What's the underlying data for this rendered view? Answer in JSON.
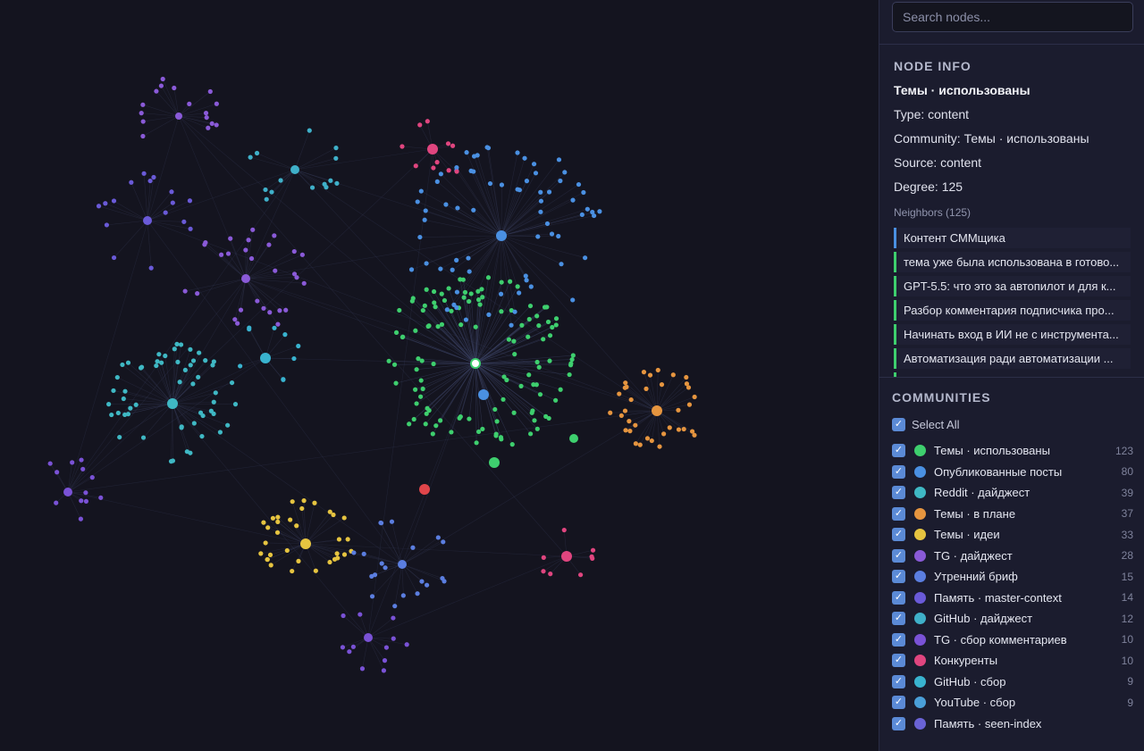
{
  "search": {
    "placeholder": "Search nodes..."
  },
  "node_info": {
    "title": "NODE INFO",
    "name": "Темы · использованы",
    "type_line": "Type: content",
    "community_line": "Community: Темы · использованы",
    "source_line": "Source: content",
    "degree_line": "Degree: 125",
    "neighbors_title": "Neighbors (125)",
    "neighbors": [
      {
        "label": "Контент СММщика",
        "color": "#4a90e2"
      },
      {
        "label": "тема уже была использована в готово...",
        "color": "#3ecf6e"
      },
      {
        "label": "GPT-5.5: что это за автопилот и для к...",
        "color": "#3ecf6e"
      },
      {
        "label": "Разбор комментария подписчика про...",
        "color": "#3ecf6e"
      },
      {
        "label": "Начинать вход в ИИ не с инструмента...",
        "color": "#3ecf6e"
      },
      {
        "label": "Автоматизация ради автоматизации ...",
        "color": "#3ecf6e"
      }
    ]
  },
  "communities": {
    "title": "COMMUNITIES",
    "select_all": "Select All",
    "items": [
      {
        "label": "Темы · использованы",
        "count": "123",
        "color": "#3ecf6e"
      },
      {
        "label": "Опубликованные посты",
        "count": "80",
        "color": "#4a90e2"
      },
      {
        "label": "Reddit · дайджест",
        "count": "39",
        "color": "#3fb8c4"
      },
      {
        "label": "Темы · в плане",
        "count": "37",
        "color": "#e6953f"
      },
      {
        "label": "Темы · идеи",
        "count": "33",
        "color": "#e6c440"
      },
      {
        "label": "TG · дайджест",
        "count": "28",
        "color": "#8a5ad8"
      },
      {
        "label": "Утренний бриф",
        "count": "15",
        "color": "#5b7ee0"
      },
      {
        "label": "Память · master-context",
        "count": "14",
        "color": "#6a5ad8"
      },
      {
        "label": "GitHub · дайджест",
        "count": "12",
        "color": "#3fb0c9"
      },
      {
        "label": "TG · сбор комментариев",
        "count": "10",
        "color": "#7a52d6"
      },
      {
        "label": "Конкуренты",
        "count": "10",
        "color": "#e0457f"
      },
      {
        "label": "GitHub · сбор",
        "count": "9",
        "color": "#39b3cf"
      },
      {
        "label": "YouTube · сбор",
        "count": "9",
        "color": "#4a9fd8"
      },
      {
        "label": "Память · seen-index",
        "count": "",
        "color": "#6a63d6"
      }
    ]
  },
  "colors": {
    "background": "#14141f",
    "sidebar": "#1b1c2e",
    "edge": "#3b4262"
  }
}
